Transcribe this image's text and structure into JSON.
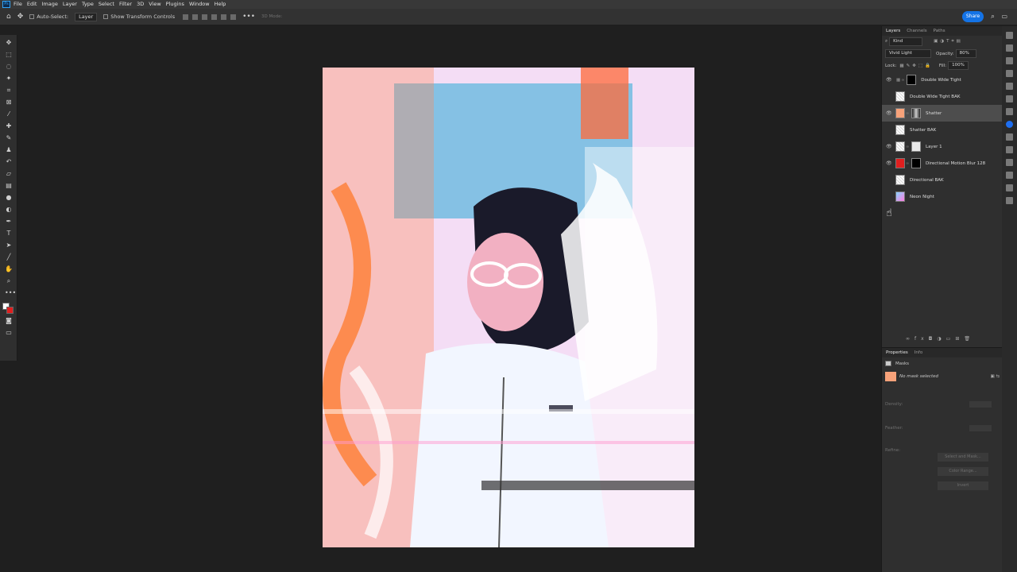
{
  "menubar": {
    "items": [
      "File",
      "Edit",
      "Image",
      "Layer",
      "Type",
      "Select",
      "Filter",
      "3D",
      "View",
      "Plugins",
      "Window",
      "Help"
    ]
  },
  "options": {
    "auto_select": "Auto-Select:",
    "auto_select_target": "Layer",
    "transform_controls": "Show Transform Controls",
    "mode_3d": "3D Mode:",
    "share": "Share"
  },
  "layers_panel": {
    "tabs": [
      "Layers",
      "Channels",
      "Paths"
    ],
    "filter": "Kind",
    "blend_mode": "Vivid Light",
    "opacity_label": "Opacity:",
    "opacity_value": "80%",
    "lock_label": "Lock:",
    "fill_label": "Fill:",
    "fill_value": "100%",
    "layers": [
      {
        "name": "Double Wide Tight",
        "visible": true,
        "thumb": "adjustment",
        "mask": "black"
      },
      {
        "name": "Double Wide Tight BAK",
        "visible": false,
        "thumb": "transparent",
        "mask": ""
      },
      {
        "name": "Shatter",
        "visible": true,
        "thumb": "peach",
        "mask": "smart",
        "selected": true
      },
      {
        "name": "Shatter BAK",
        "visible": false,
        "thumb": "transparent",
        "mask": ""
      },
      {
        "name": "Layer 1",
        "visible": true,
        "thumb": "transparent",
        "mask": "white"
      },
      {
        "name": "Directional Motion Blur 128",
        "visible": true,
        "thumb": "red",
        "mask": "black"
      },
      {
        "name": "Directional BAK",
        "visible": false,
        "thumb": "transparent",
        "mask": ""
      },
      {
        "name": "Neon Night",
        "visible": false,
        "thumb": "photo",
        "mask": ""
      }
    ]
  },
  "properties_panel": {
    "tabs": [
      "Properties",
      "Info"
    ],
    "section": "Masks",
    "status": "No mask selected",
    "density_label": "Density:",
    "feather_label": "Feather:",
    "refine_label": "Refine:",
    "buttons": [
      "Select and Mask...",
      "Color Range...",
      "Invert"
    ]
  }
}
